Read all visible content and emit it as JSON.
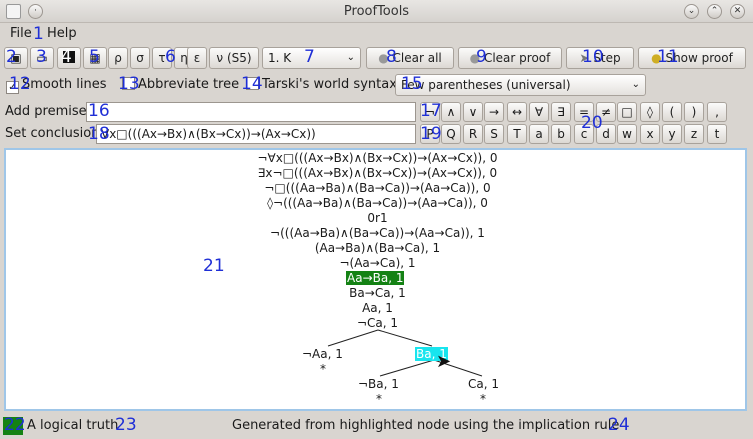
{
  "window": {
    "title": "ProofTools",
    "buttons": [
      "⌄",
      "⌃",
      "✕"
    ]
  },
  "menu": {
    "file": "File",
    "help": "Help"
  },
  "toolbar": {
    "symbols": [
      "ρ",
      "σ",
      "τ",
      "η",
      "ε"
    ],
    "logic_mode": "ν (S5)",
    "system_select": "1. K",
    "clear_all": "Clear all",
    "clear_proof": "Clear proof",
    "step": "Step",
    "show_proof": "Show proof"
  },
  "options": {
    "smooth_lines": "Smooth lines",
    "abbreviate_tree": "Abbreviate tree",
    "tarski_syntax": "Tarski's world syntax",
    "parentheses_select": "Few parentheses (universal)"
  },
  "premise": {
    "label": "Add premise:",
    "value": ""
  },
  "conclusion": {
    "label": "Set conclusion:",
    "value": "∀x□(((Ax→Bx)∧(Bx→Cx))→(Ax→Cx))"
  },
  "symbol_keys_row1": [
    "¬",
    "∧",
    "∨",
    "→",
    "↔",
    "∀",
    "∃",
    "=",
    "≠",
    "□",
    "◊",
    "(",
    ")",
    ","
  ],
  "symbol_keys_row2": [
    "P",
    "Q",
    "R",
    "S",
    "T",
    "a",
    "b",
    "c",
    "d",
    "w",
    "x",
    "y",
    "z",
    "t"
  ],
  "tree": {
    "lines": [
      "¬∀x□(((Ax→Bx)∧(Bx→Cx))→(Ax→Cx)), 0",
      "∃x¬□(((Ax→Bx)∧(Bx→Cx))→(Ax→Cx)), 0",
      "¬□(((Aa→Ba)∧(Ba→Ca))→(Aa→Ca)), 0",
      "◊¬(((Aa→Ba)∧(Ba→Ca))→(Aa→Ca)), 0",
      "0r1",
      "¬(((Aa→Ba)∧(Ba→Ca))→(Aa→Ca)), 1",
      "(Aa→Ba)∧(Ba→Ca), 1",
      "¬(Aa→Ca), 1",
      "Aa→Ba, 1",
      "Ba→Ca, 1",
      "Aa, 1",
      "¬Ca, 1"
    ],
    "left_branch": {
      "node": "¬Aa, 1",
      "close": "*"
    },
    "right_branch": {
      "node": "Ba, 1"
    },
    "right_left_branch": {
      "node": "¬Ba, 1",
      "close": "*"
    },
    "right_right_branch": {
      "node": "Ca, 1",
      "close": "*"
    }
  },
  "status": {
    "left": "A logical truth",
    "right": "Generated from highlighted node using the implication rule"
  },
  "markers": [
    "1",
    "2",
    "3",
    "4",
    "5",
    "6",
    "7",
    "8",
    "9",
    "10",
    "11",
    "12",
    "13",
    "14",
    "15",
    "16",
    "17",
    "18",
    "19",
    "20",
    "21",
    "22",
    "23",
    "24"
  ],
  "colors": {
    "selection_green": "#148214",
    "highlight_cyan": "#18e5ee",
    "panel_border": "#9fc6e8",
    "marker_blue": "#1f2fd6"
  }
}
